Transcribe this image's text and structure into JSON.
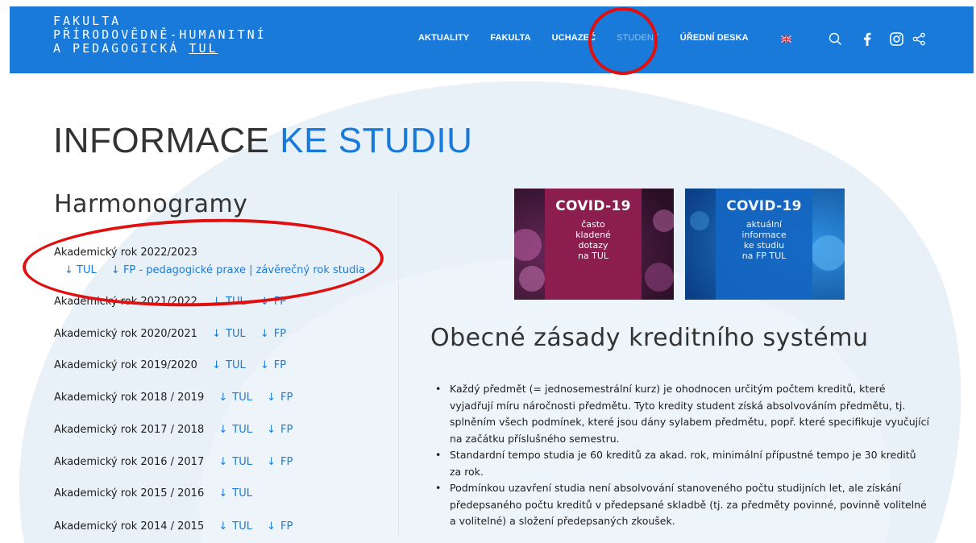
{
  "logo": {
    "line1": "FAKULTA",
    "line2": "PŘÍRODOVĚDNĚ-HUMANITNÍ",
    "line3_prefix": "A PEDAGOGICKÁ ",
    "line3_tul": "TUL"
  },
  "nav": {
    "items": [
      {
        "label": "AKTUALITY"
      },
      {
        "label": "FAKULTA"
      },
      {
        "label": "UCHAZEČ"
      },
      {
        "label": "STUDENT"
      },
      {
        "label": "ÚŘEDNÍ DESKA"
      }
    ]
  },
  "colors": {
    "header": "#1a7ad9",
    "accent": "#1a7ad9",
    "annotation": "#e01010",
    "banner1": "#8b1e4e",
    "banner2": "#1466c2"
  },
  "icons": [
    "uk-flag-icon",
    "search-icon",
    "facebook-icon",
    "instagram-icon",
    "share-icon",
    "download-arrow-icon"
  ],
  "page": {
    "title_plain": "INFORMACE ",
    "title_accent": "KE STUDIU"
  },
  "harmonogramy": {
    "heading": "Harmonogramy",
    "arrow": "↓",
    "first": {
      "year": "Akademický rok 2022/2023",
      "links": [
        "TUL",
        "FP - pedagogické praxe | závěrečný rok studia"
      ]
    },
    "years": [
      {
        "year": "Akademický rok 2021/2022",
        "links": [
          "TUL",
          "FP"
        ]
      },
      {
        "year": "Akademický rok 2020/2021",
        "links": [
          "TUL",
          "FP"
        ]
      },
      {
        "year": "Akademický rok 2019/2020",
        "links": [
          "TUL",
          "FP"
        ]
      },
      {
        "year": "Akademický rok 2018 / 2019",
        "links": [
          "TUL",
          "FP"
        ]
      },
      {
        "year": "Akademický rok 2017 / 2018",
        "links": [
          "TUL",
          "FP"
        ]
      },
      {
        "year": "Akademický rok 2016 / 2017",
        "links": [
          "TUL",
          "FP"
        ]
      },
      {
        "year": "Akademický rok 2015 / 2016",
        "links": [
          "TUL"
        ]
      },
      {
        "year": "Akademický rok 2014 / 2015",
        "links": [
          "TUL",
          "FP"
        ]
      }
    ]
  },
  "banners": [
    {
      "title": "COVID-19",
      "lines": [
        "často",
        "kladené",
        "dotazy",
        "na TUL"
      ]
    },
    {
      "title": "COVID-19",
      "lines": [
        "aktuální",
        "informace",
        "ke studiu",
        "na FP TUL"
      ]
    }
  ],
  "credit": {
    "heading": "Obecné zásady kreditního systému",
    "items": [
      "Každý předmět (= jednosemestrální kurz) je ohodnocen určitým počtem kreditů, které vyjadřují míru náročnosti předmětu. Tyto kredity student získá absolvováním předmětu, tj. splněním všech podmínek, které jsou dány sylabem předmětu, popř. které specifikuje vyučující na začátku příslušného semestru.",
      "Standardní tempo studia je 60 kreditů za akad. rok, minimální přípustné tempo je 30 kreditů za rok.",
      "Podmínkou uzavření studia není absolvování stanoveného počtu studijních let, ale získání předepsaného počtu kreditů v předepsané skladbě (tj. za předměty povinné, povinně volitelné a volitelné) a složení předepsaných zkoušek."
    ]
  }
}
